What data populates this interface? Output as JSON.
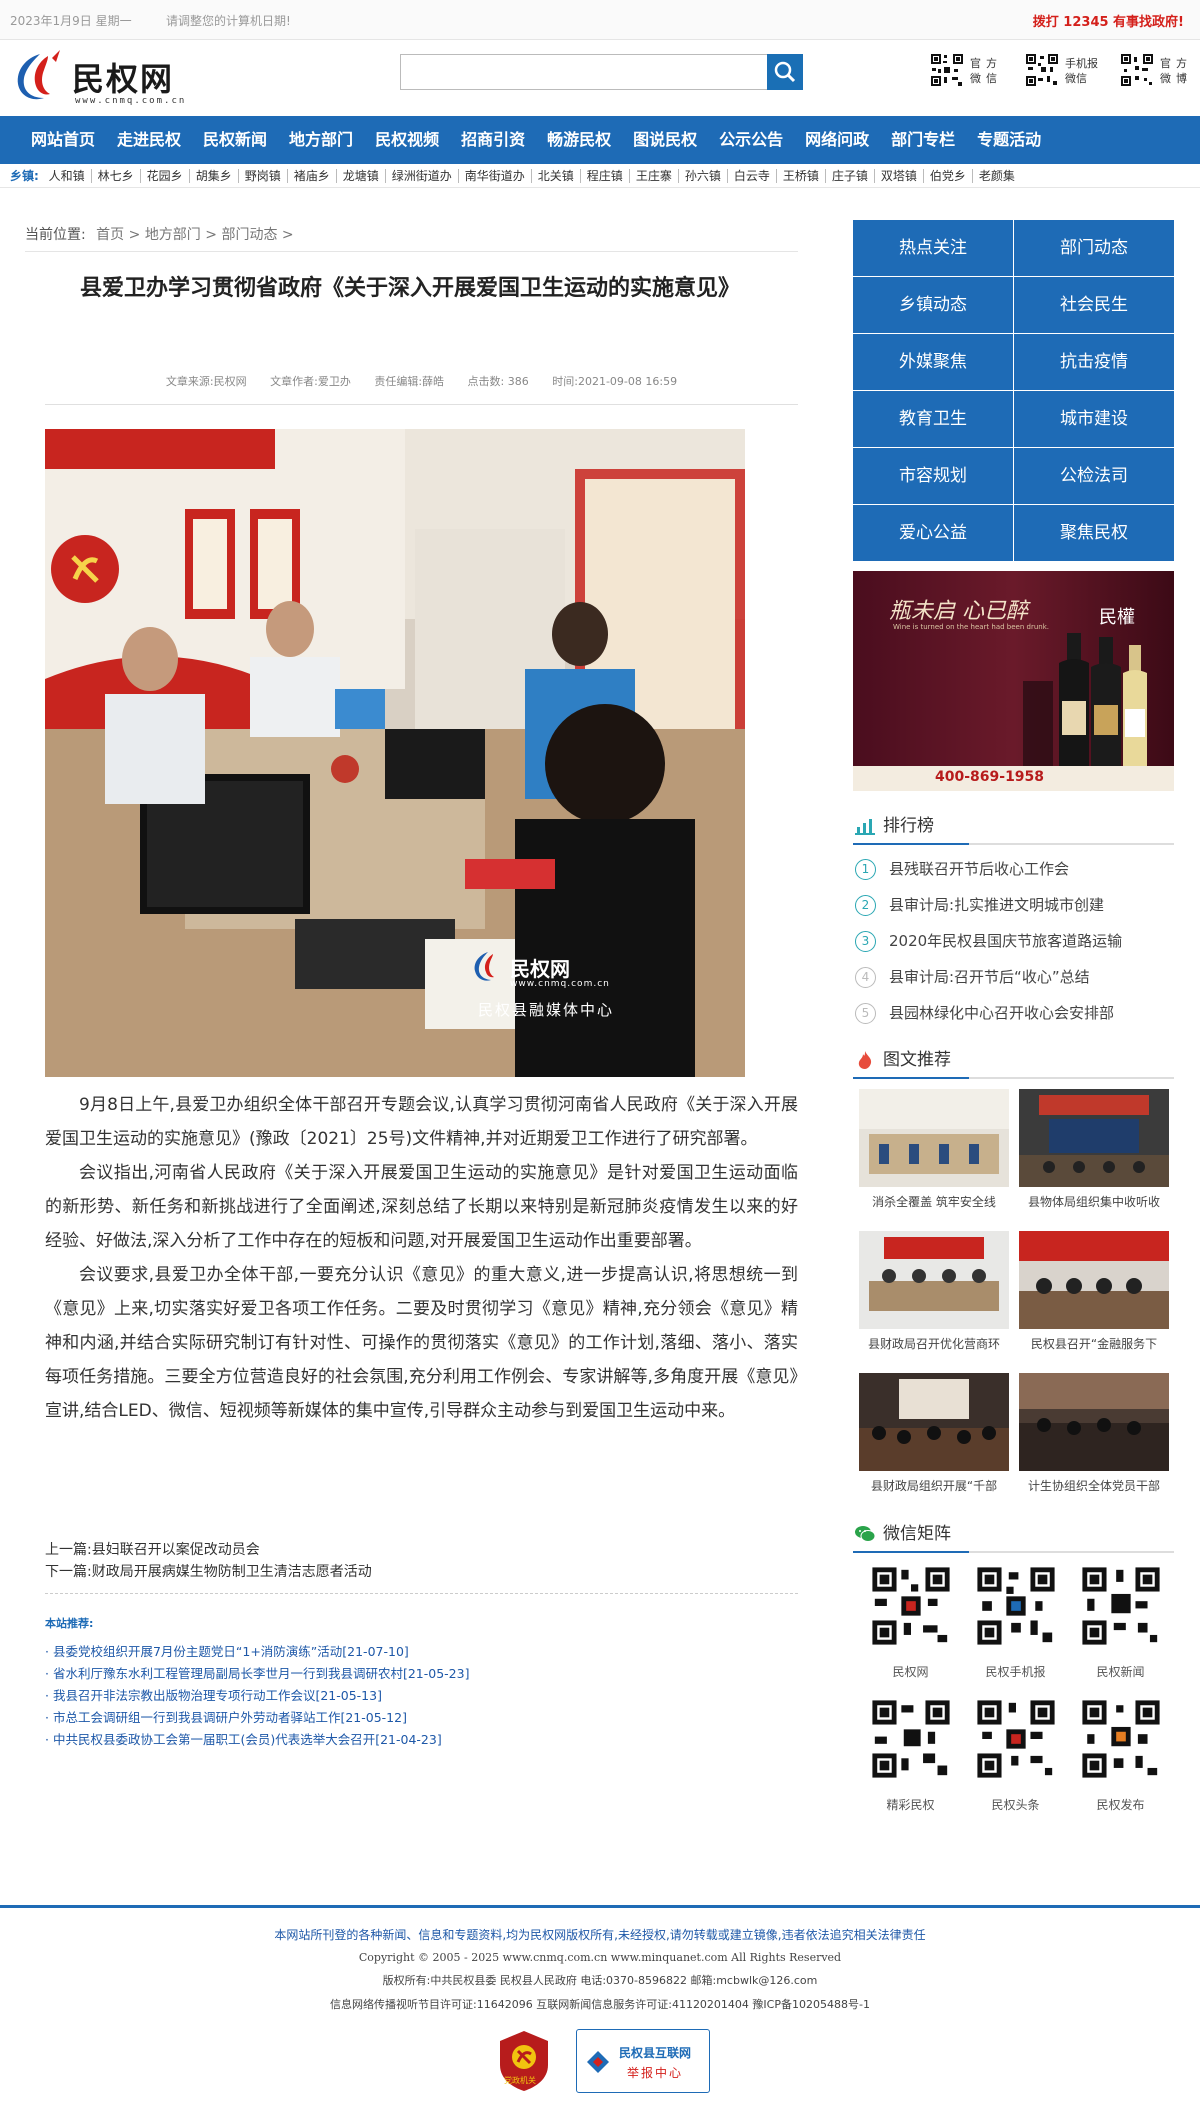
{
  "topbar": {
    "date": "2023年1月9日 星期一",
    "notice": "请调整您的计算机日期!",
    "hotline": "拨打 12345 有事找政府!"
  },
  "header": {
    "logo_text": "民权网",
    "logo_domain": "www.cnmq.com.cn",
    "search_placeholder": "",
    "qr_items": [
      {
        "label": "官方微信"
      },
      {
        "label": "手机报微信"
      },
      {
        "label": "官方微博"
      }
    ]
  },
  "nav": {
    "items": [
      "网站首页",
      "走进民权",
      "民权新闻",
      "地方部门",
      "民权视频",
      "招商引资",
      "畅游民权",
      "图说民权",
      "公示公告",
      "网络问政",
      "部门专栏",
      "专题活动"
    ]
  },
  "towns": {
    "label": "乡镇:",
    "items": [
      "人和镇",
      "林七乡",
      "花园乡",
      "胡集乡",
      "野岗镇",
      "褚庙乡",
      "龙塘镇",
      "绿洲街道办",
      "南华街道办",
      "北关镇",
      "程庄镇",
      "王庄寨",
      "孙六镇",
      "白云寺",
      "王桥镇",
      "庄子镇",
      "双塔镇",
      "伯党乡",
      "老颜集"
    ]
  },
  "breadcrumb": {
    "prefix": "当前位置:",
    "home": "首页",
    "sep1": " > ",
    "level1": "地方部门",
    "sep2": " > ",
    "level2": "部门动态",
    "sep3": " >"
  },
  "article": {
    "title": "县爱卫办学习贯彻省政府《关于深入开展爱国卫生运动的实施意见》",
    "meta": {
      "source": "文章来源:民权网",
      "author": "文章作者:爱卫办",
      "editor": "责任编辑:薛皓",
      "clicks": "点击数: 386",
      "time": "时间:2021-09-08 16:59"
    },
    "watermark_name": "民权网",
    "watermark_domain": "www.cnmq.com.cn",
    "watermark_center": "民权县融媒体中心",
    "paragraphs": [
      "9月8日上午,县爱卫办组织全体干部召开专题会议,认真学习贯彻河南省人民政府《关于深入开展爱国卫生运动的实施意见》(豫政〔2021〕25号)文件精神,并对近期爱卫工作进行了研究部署。",
      "会议指出,河南省人民政府《关于深入开展爱国卫生运动的实施意见》是针对爱国卫生运动面临的新形势、新任务和新挑战进行了全面阐述,深刻总结了长期以来特别是新冠肺炎疫情发生以来的好经验、好做法,深入分析了工作中存在的短板和问题,对开展爱国卫生运动作出重要部署。",
      "会议要求,县爱卫办全体干部,一要充分认识《意见》的重大意义,进一步提高认识,将思想统一到《意见》上来,切实落实好爱卫各项工作任务。二要及时贯彻学习《意见》精神,充分领会《意见》精神和内涵,并结合实际研究制订有针对性、可操作的贯彻落实《意见》的工作计划,落细、落小、落实每项任务措施。三要全方位营造良好的社会氛围,充分利用工作例会、专家讲解等,多角度开展《意见》宣讲,结合LED、微信、短视频等新媒体的集中宣传,引导群众主动参与到爱国卫生运动中来。"
    ],
    "prev": "上一篇:县妇联召开以案促改动员会",
    "next": "下一篇:财政局开展病媒生物防制卫生清洁志愿者活动"
  },
  "related": {
    "heading": "本站推荐:",
    "items": [
      "· 县委党校组织开展7月份主题党日“1+消防演练”活动[21-07-10]",
      "· 省水利厅豫东水利工程管理局副局长李世月一行到我县调研农村[21-05-23]",
      "· 我县召开非法宗教出版物治理专项行动工作会议[21-05-13]",
      "· 市总工会调研组一行到我县调研户外劳动者驿站工作[21-05-12]",
      "· 中共民权县委政协工会第一届职工(会员)代表选举大会召开[21-04-23]"
    ]
  },
  "sidebar": {
    "categories": [
      "热点关注",
      "部门动态",
      "乡镇动态",
      "社会民生",
      "外媒聚焦",
      "抗击疫情",
      "教育卫生",
      "城市建设",
      "市容规划",
      "公检法司",
      "爱心公益",
      "聚焦民权"
    ],
    "ad": {
      "slogan": "瓶未启 心已醉",
      "slogan_sub": "Wine is turned on the heart had been drunk.",
      "brand": "民權",
      "phone": "400-869-1958"
    },
    "ranking": {
      "title": "排行榜",
      "items": [
        {
          "n": "1",
          "text": "县残联召开节后收心工作会"
        },
        {
          "n": "2",
          "text": "县审计局:扎实推进文明城市创建"
        },
        {
          "n": "3",
          "text": "2020年民权县国庆节旅客道路运输"
        },
        {
          "n": "4",
          "text": "县审计局:召开节后“收心”总结"
        },
        {
          "n": "5",
          "text": "县园林绿化中心召开收心会安排部"
        }
      ]
    },
    "pictures": {
      "title": "图文推荐",
      "items": [
        {
          "caption": "消杀全覆盖 筑牢安全线"
        },
        {
          "caption": "县物体局组织集中收听收"
        },
        {
          "caption": "县财政局召开优化营商环"
        },
        {
          "caption": "民权县召开“金融服务下"
        },
        {
          "caption": "县财政局组织开展“千部"
        },
        {
          "caption": "计生协组织全体党员干部"
        }
      ]
    },
    "wechat": {
      "title": "微信矩阵",
      "items": [
        "民权网",
        "民权手机报",
        "民权新闻",
        "精彩民权",
        "民权头条",
        "民权发布"
      ]
    }
  },
  "footer": {
    "line1": "本网站所刊登的各种新闻、信息和专题资料,均为民权网版权所有,未经授权,请勿转载或建立镜像,违者依法追究相关法律责任",
    "line2": "Copyright © 2005 - 2025 www.cnmq.com.cn www.minquanet.com All Rights Reserved",
    "line3": "版权所有:中共民权县委 民权县人民政府 电话:0370-8596822 邮箱:mcbwlk@126.com",
    "line4": "信息网络传播视听节目许可证:11642096 互联网新闻信息服务许可证:41120201404 豫ICP备10205488号-1",
    "badge1": "党政机关",
    "badge2_title": "民权县互联网",
    "badge2_sub": "举报中心"
  },
  "colors": {
    "brand_blue": "#1e6bb6",
    "hotline_red": "#d4201b",
    "rank_teal": "#2aa7b3"
  }
}
